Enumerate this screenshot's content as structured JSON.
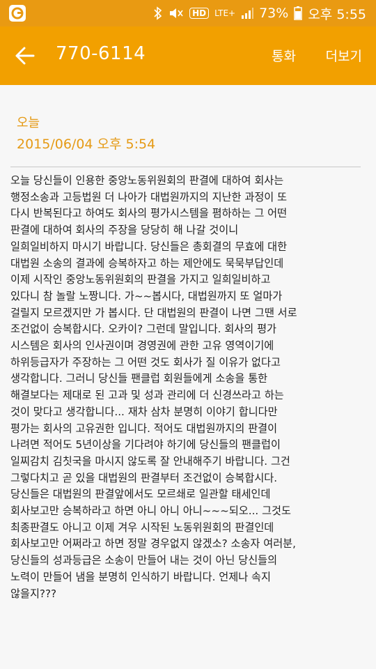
{
  "status_bar": {
    "battery_percent": "73%",
    "time": "오후 5:55",
    "network": "LTE+",
    "hd_label": "HD",
    "icons": [
      "app-logo-icon",
      "bluetooth-icon",
      "mute-icon",
      "hd-voice-icon",
      "lte-icon",
      "signal-icon",
      "battery-icon"
    ]
  },
  "header": {
    "title": "770-6114",
    "call_label": "통화",
    "more_label": "더보기",
    "back_icon": "arrow-left-icon"
  },
  "message": {
    "day_label": "오늘",
    "datetime": "2015/06/04  오후 5:54",
    "lines": [
      "오늘 당신들이 인용한 중앙노동위원회의 판결에 대하여 회사는",
      "행정소송과 고등법원 더 나아가 대법원까지의 지난한 과정이 또",
      "다시 반복된다고 하여도 회사의 평가시스템을 폄하하는 그 어떤",
      "판결에 대하여 회사의 주장을 당당히 해 나갈 것이니",
      "일희일비하지 마시기 바랍니다. 당신들은 총회결의 무효에 대한",
      "대법원 소송의 결과에 승복하자고 하는 제안에도 묵묵부답인데",
      "이제 시작인 중앙노동위원회의 판결을 가지고 일희일비하고",
      "있다니 참 놀랄 노짱니다. 가~~봅시다, 대법원까지 또 얼마가",
      "걸릴지 모르겠지만 가 봅시다. 단 대법원의 판결이 나면 그땐 서로",
      "조건없이 승복합시다. 오카이? 그런데 말입니다. 회사의 평가",
      "시스템은 회사의 인사권이며 경영권에 관한 고유 영역이기에",
      "하위등급자가 주장하는 그 어떤 것도 회사가 질 이유가 없다고",
      "생각합니다. 그러니 당신들 팬클럽 회원들에게 소송을 통한",
      "해결보다는 제대로 된 고과 및 성과 관리에 더 신경쓰라고 하는",
      "것이 맞다고 생각합니다... 재차 삼차 분명히 이야기 합니다만",
      "평가는 회사의 고유권한 입니다. 적어도 대법원까지의 판결이",
      "나려면 적어도 5년이상을 기다려야 하기에 당신들의 팬클럽이",
      "일찌감치 김칫국을 마시지 않도록 잘 안내해주기 바랍니다. 그건",
      "그렇다치고 곧 있을 대법원의 판결부터 조건없이 승복합시다.",
      "당신들은 대법원의 판결앞에서도 모르쇄로 일관할 태세인데",
      "회사보고만 승복하라고 하면 아니 아니 아니~~~되오... 그것도",
      "최종판결도 아니고 이제 겨우 시작된 노동위원회의 판결인데",
      "회사보고만 어쩌라고 하면 정말 경우없지 않겠소? 소송자 여러분,",
      "당신들의 성과등급은 소송이 만들어 내는 것이 아닌 당신들의",
      "노력이 만들어 냄을 분명히 인식하기 바랍니다. 언제나 속지",
      "않을지???"
    ]
  },
  "colors": {
    "status_bar": "#e99a12",
    "app_bar": "#f2a000",
    "accent_text": "#e59a15",
    "background": "#f7f7f7",
    "body_text": "#222222"
  }
}
